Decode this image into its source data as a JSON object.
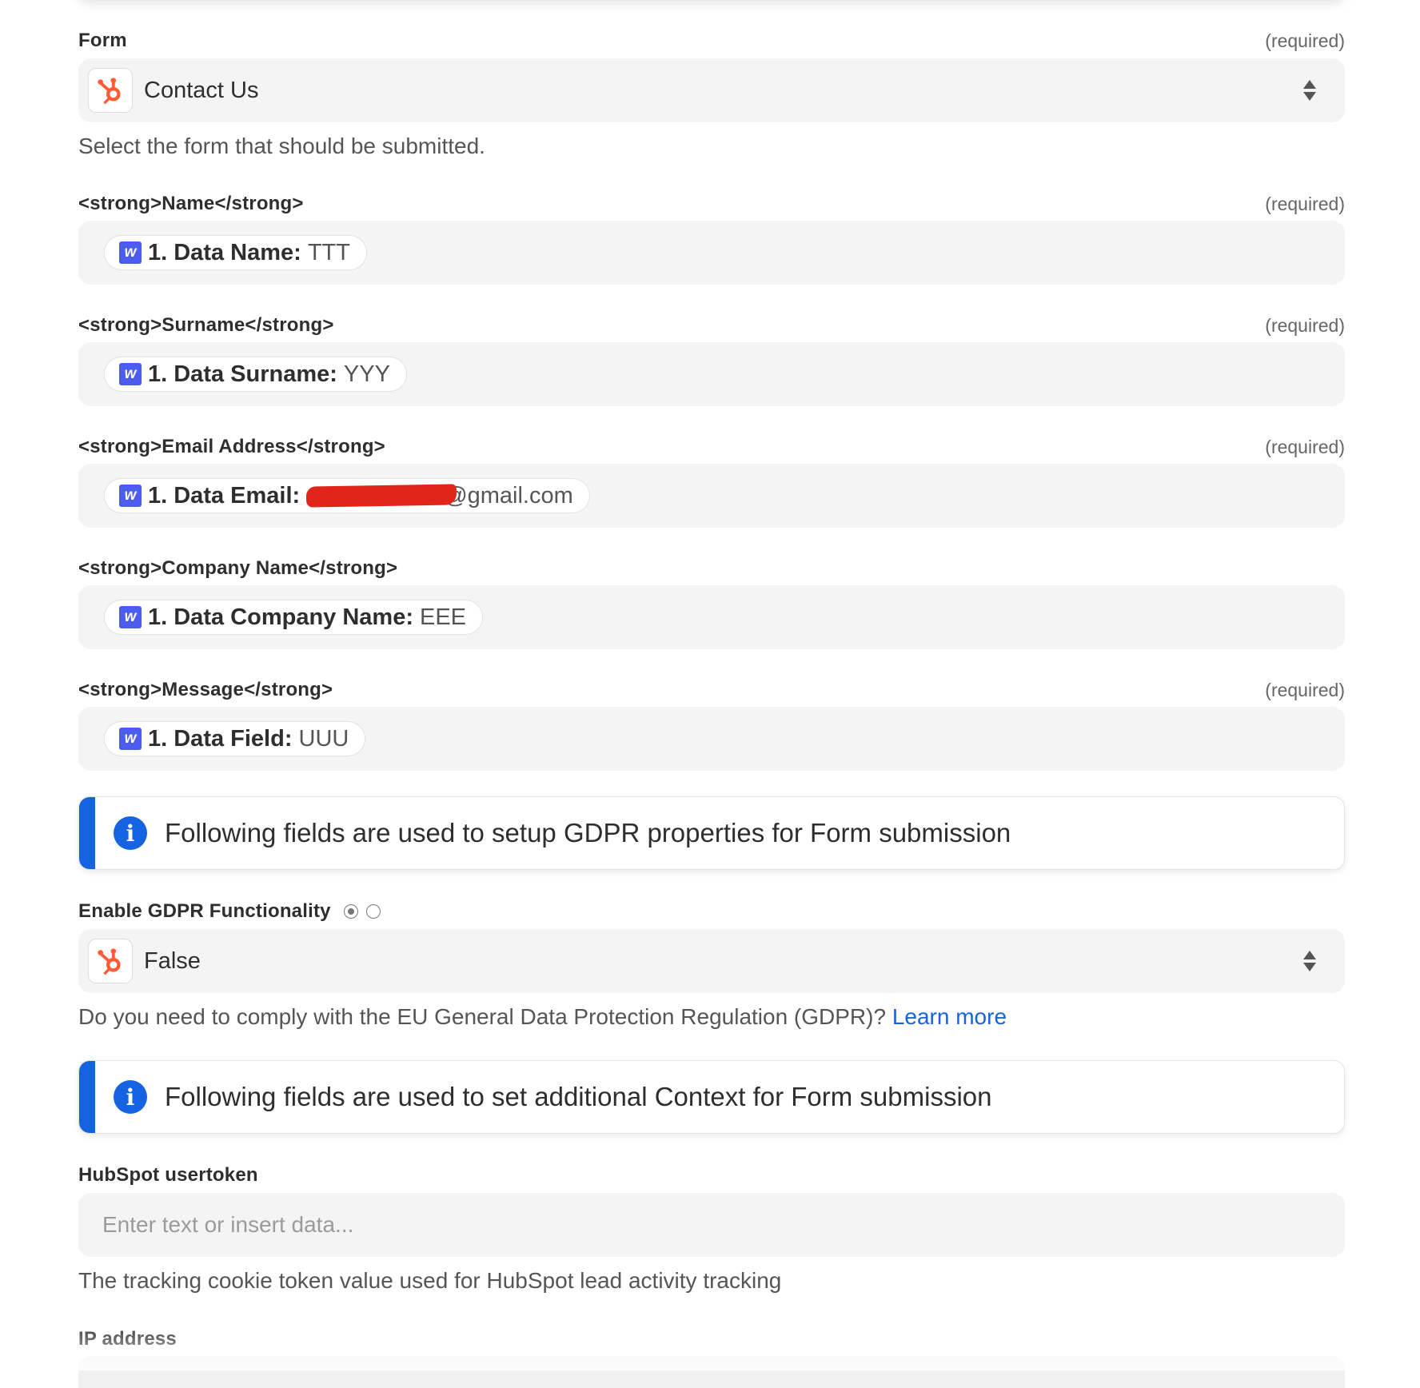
{
  "form_field": {
    "label": "Form",
    "required": "(required)",
    "value": "Contact Us",
    "help": "Select the form that should be submitted.",
    "icon": "hubspot-icon"
  },
  "mapped_fields": [
    {
      "label": "<strong>Name</strong>",
      "required": "(required)",
      "key": "1. Data Name:",
      "value": "TTT"
    },
    {
      "label": "<strong>Surname</strong>",
      "required": "(required)",
      "key": "1. Data Surname:",
      "value": "YYY"
    },
    {
      "label": "<strong>Email Address</strong>",
      "required": "(required)",
      "key": "1. Data Email:",
      "value": "@gmail.com"
    },
    {
      "label": "<strong>Company Name</strong>",
      "required": "",
      "key": "1. Data Company Name:",
      "value": "EEE"
    },
    {
      "label": "<strong>Message</strong>",
      "required": "(required)",
      "key": "1. Data Field:",
      "value": "UUU"
    }
  ],
  "pill_badge": "w",
  "gdpr_info": "Following fields are used to setup GDPR properties for Form submission",
  "gdpr_field": {
    "label": "Enable GDPR Functionality",
    "value": "False",
    "help": "Do you need to comply with the EU General Data Protection Regulation (GDPR)?",
    "link": "Learn more"
  },
  "context_info": "Following fields are used to set additional Context for Form submission",
  "usertoken_field": {
    "label": "HubSpot usertoken",
    "placeholder": "Enter text or insert data...",
    "help": "The tracking cookie token value used for HubSpot lead activity tracking"
  },
  "ip_field": {
    "label": "IP address"
  },
  "colors": {
    "accent": "#1563e0",
    "hubspot": "#ff5c35",
    "badge": "#4d5cf0",
    "field_bg": "#f4f4f4"
  }
}
